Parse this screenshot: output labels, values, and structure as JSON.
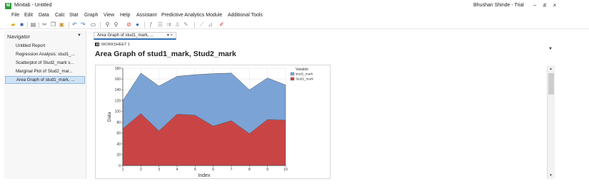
{
  "window": {
    "title": "Minitab - Untitled",
    "user": "Bhushan Shinde - Trial",
    "controls": {
      "minimize": "–",
      "restore": "#",
      "close": "×"
    }
  },
  "menu": [
    "File",
    "Edit",
    "Data",
    "Calc",
    "Stat",
    "Graph",
    "View",
    "Help",
    "Assistant",
    "Predictive Analytics Module",
    "Additional Tools"
  ],
  "navigator": {
    "title": "Navigator",
    "items": [
      {
        "label": "Untitled Report",
        "active": false
      },
      {
        "label": "Regression Analysis: stud1_...",
        "active": false
      },
      {
        "label": "Scatterplot of Stud2_mark v...",
        "active": false
      },
      {
        "label": "Marginal Plot of Stud2_mar...",
        "active": false
      },
      {
        "label": "Area Graph of stud1_mark, ...",
        "active": true
      }
    ]
  },
  "tab": {
    "label": "Area Graph of stud1_mark, ...",
    "controls": "▾ ×"
  },
  "worksheet_label": "WORKSHEET 1",
  "page_title": "Area Graph of stud1_mark, Stud2_mark",
  "chart_data": {
    "type": "area",
    "stacked": true,
    "title": "",
    "xlabel": "Index",
    "ylabel": "Data",
    "x": [
      1,
      2,
      3,
      4,
      5,
      6,
      7,
      8,
      9,
      10
    ],
    "ylim": [
      0,
      180
    ],
    "yticks": [
      0,
      20,
      40,
      60,
      80,
      100,
      120,
      140,
      160,
      180
    ],
    "grid": true,
    "legend_title": "Variable",
    "legend_position": "top-right",
    "series": [
      {
        "name": "stud1_mark",
        "color": "#7ba3d6",
        "values": [
          52,
          75,
          83,
          70,
          75,
          97,
          88,
          81,
          77,
          65
        ]
      },
      {
        "name": "Stud2_mark",
        "color": "#c94545",
        "values": [
          68,
          96,
          64,
          95,
          93,
          73,
          83,
          59,
          85,
          84
        ]
      }
    ]
  },
  "colors": {
    "accent": "#2f6fb5",
    "selection": "#cfe3f6",
    "app_icon": "#2e9b3a"
  }
}
